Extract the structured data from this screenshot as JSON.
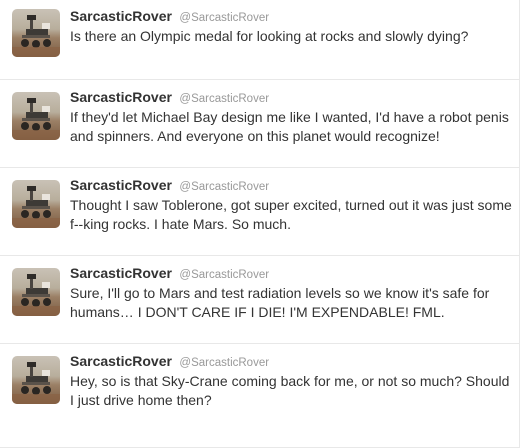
{
  "colors": {
    "name": "#333333",
    "handle": "#999999",
    "divider": "#e8e8e8"
  },
  "tweets": [
    {
      "name": "SarcasticRover",
      "handle": "@SarcasticRover",
      "avatar_icon": "mars-rover-avatar",
      "text": "Is there an Olympic medal for looking at rocks and slowly dying?"
    },
    {
      "name": "SarcasticRover",
      "handle": "@SarcasticRover",
      "avatar_icon": "mars-rover-avatar",
      "text": "If they'd let Michael Bay design me like I wanted, I'd have a robot penis and spinners. And everyone on this planet would recognize!"
    },
    {
      "name": "SarcasticRover",
      "handle": "@SarcasticRover",
      "avatar_icon": "mars-rover-avatar",
      "text": "Thought I saw Toblerone, got super excited, turned out it was just some f--king rocks. I hate Mars. So much."
    },
    {
      "name": "SarcasticRover",
      "handle": "@SarcasticRover",
      "avatar_icon": "mars-rover-avatar",
      "text": "Sure, I'll go to Mars and test radiation levels so we know it's safe for humans… I DON'T CARE IF I DIE! I'M EXPENDABLE! FML."
    },
    {
      "name": "SarcasticRover",
      "handle": "@SarcasticRover",
      "avatar_icon": "mars-rover-avatar",
      "text": "Hey, so is that Sky-Crane coming back for me, or not so much? Should I just drive home then?"
    }
  ]
}
